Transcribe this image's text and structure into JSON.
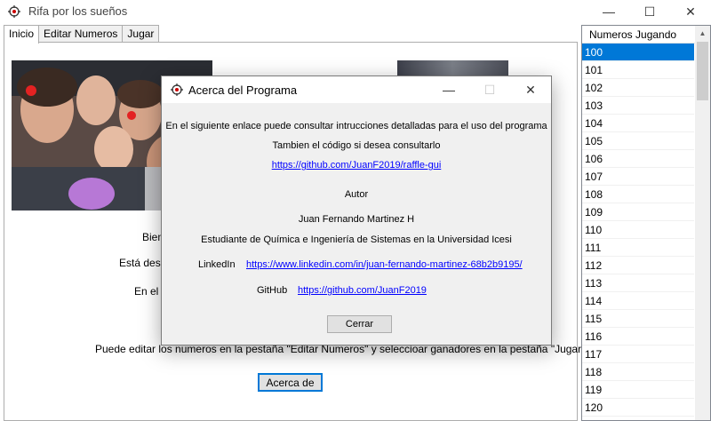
{
  "window": {
    "title": "Rifa por los sueños",
    "minimize": "—",
    "maximize": "☐",
    "close": "✕"
  },
  "tabs": [
    "Inicio",
    "Editar Numeros",
    "Jugar"
  ],
  "inicio": {
    "line1": "Bien",
    "line2": "Está desti",
    "line3": "En el s",
    "edit_hint": "Puede editar los numeros en la pestaña \"Editar Numeros\" y seleccioar ganadores en la pestaña \"Jugar\".",
    "acerca_button": "Acerca de"
  },
  "list": {
    "header": "Numeros Jugando",
    "items": [
      "100",
      "101",
      "102",
      "103",
      "104",
      "105",
      "106",
      "107",
      "108",
      "109",
      "110",
      "111",
      "112",
      "113",
      "114",
      "115",
      "116",
      "117",
      "118",
      "119",
      "120"
    ],
    "selected_index": 0
  },
  "dialog": {
    "title": "Acerca del Programa",
    "minimize": "—",
    "maximize": "☐",
    "close": "✕",
    "intro": "En el siguiente enlace puede consultar intrucciones detalladas para el uso del programa",
    "code_note": "Tambien el código si desea consultarlo",
    "repo_link": "https://github.com/JuanF2019/raffle-gui",
    "author_label": "Autor",
    "author_name": "Juan Fernando Martinez H",
    "author_desc": "Estudiante de Química e Ingeniería de Sistemas en la Universidad Icesi",
    "linkedin_label": "LinkedIn",
    "linkedin_link": "https://www.linkedin.com/in/juan-fernando-martinez-68b2b9195/",
    "github_label": "GitHub",
    "github_link": "https://github.com/JuanF2019",
    "close_button": "Cerrar"
  },
  "colors": {
    "selection": "#0078d7",
    "link": "#0000ff"
  }
}
